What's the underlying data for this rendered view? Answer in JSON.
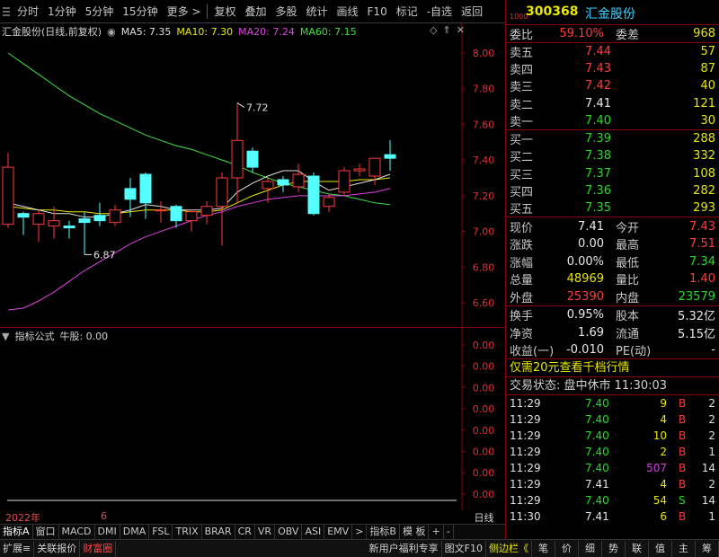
{
  "toolbar": {
    "items": [
      {
        "label": "分时",
        "active": false
      },
      {
        "label": "1分钟",
        "active": false
      },
      {
        "label": "5分钟",
        "active": false
      },
      {
        "label": "15分钟",
        "active": false
      },
      {
        "label": "更多 >",
        "active": false
      },
      {
        "label": "复权",
        "active": false
      },
      {
        "label": "叠加",
        "active": false
      },
      {
        "label": "多股",
        "active": false
      },
      {
        "label": "统计",
        "active": false
      },
      {
        "label": "画线",
        "active": false
      },
      {
        "label": "F10",
        "active": false
      },
      {
        "label": "标记",
        "active": false
      },
      {
        "label": "-自选",
        "active": false
      },
      {
        "label": "返回",
        "active": false
      }
    ]
  },
  "chart_header": {
    "stock_title": "汇金股份(日线,前复权)",
    "ma5": "MA5: 7.35",
    "ma10": "MA10: 7.30",
    "ma20": "MA20: 7.24",
    "ma60": "MA60: 7.15",
    "ctrl_icons": [
      "diamond-icon",
      "up-arrow-icon",
      "close-icon"
    ]
  },
  "indicator_header": {
    "formula": "指标公式",
    "value": "牛股: 0.00"
  },
  "date_axis": {
    "year": "2022年",
    "month": "6"
  },
  "daxian_label": "日线",
  "indicator_tabs": [
    "指标A",
    "窗口",
    "MACD",
    "DMI",
    "DMA",
    "FSL",
    "TRIX",
    "BRAR",
    "CR",
    "VR",
    "OBV",
    "ASI",
    "EMV",
    ">",
    "指标B",
    "模 板",
    "+",
    "-"
  ],
  "bottom_bar": {
    "left": [
      "扩展≡",
      "关联报价",
      "财富圈"
    ],
    "right": [
      "新用户福利专享",
      "图文F10",
      "侧边栏《"
    ],
    "quick": [
      "笔",
      "价",
      "细",
      "势",
      "联",
      "值",
      "主",
      "筹"
    ]
  },
  "right_panel": {
    "num": "1000",
    "code": "300368",
    "name": "汇金股份",
    "weibi": {
      "label": "委比",
      "value": "59.10%",
      "label2": "委差",
      "value2": "968"
    },
    "sell": [
      {
        "label": "卖五",
        "price": "7.44",
        "qty": "57"
      },
      {
        "label": "卖四",
        "price": "7.43",
        "qty": "87"
      },
      {
        "label": "卖三",
        "price": "7.42",
        "qty": "40"
      },
      {
        "label": "卖二",
        "price": "7.41",
        "qty": "121"
      },
      {
        "label": "卖一",
        "price": "7.40",
        "qty": "30"
      }
    ],
    "buy": [
      {
        "label": "买一",
        "price": "7.39",
        "qty": "288"
      },
      {
        "label": "买二",
        "price": "7.38",
        "qty": "332"
      },
      {
        "label": "买三",
        "price": "7.37",
        "qty": "108"
      },
      {
        "label": "买四",
        "price": "7.36",
        "qty": "282"
      },
      {
        "label": "买五",
        "price": "7.35",
        "qty": "293"
      }
    ],
    "stats": [
      {
        "l": "现价",
        "v": "7.41",
        "vc": "white",
        "l2": "今开",
        "v2": "7.43",
        "v2c": "red"
      },
      {
        "l": "涨跌",
        "v": "0.00",
        "vc": "white",
        "l2": "最高",
        "v2": "7.51",
        "v2c": "red"
      },
      {
        "l": "涨幅",
        "v": "0.00%",
        "vc": "white",
        "l2": "最低",
        "v2": "7.34",
        "v2c": "green"
      },
      {
        "l": "总量",
        "v": "48969",
        "vc": "yellow",
        "l2": "量比",
        "v2": "1.40",
        "v2c": "red"
      },
      {
        "l": "外盘",
        "v": "25390",
        "vc": "red",
        "l2": "内盘",
        "v2": "23579",
        "v2c": "green"
      }
    ],
    "stats2": [
      {
        "l": "换手",
        "v": "0.95%",
        "vc": "white",
        "l2": "股本",
        "v2": "5.32亿",
        "v2c": "white"
      },
      {
        "l": "净资",
        "v": "1.69",
        "vc": "white",
        "l2": "流通",
        "v2": "5.15亿",
        "v2c": "white"
      },
      {
        "l": "收益(一)",
        "v": "-0.010",
        "vc": "white",
        "l2": "PE(动)",
        "v2": "-",
        "v2c": "white"
      }
    ],
    "promo": "仅需20元查看千档行情",
    "trade_status": "交易状态: 盘中休市 11:30:03",
    "ticks": [
      {
        "time": "11:29",
        "price": "7.40",
        "pc": "green",
        "vol": "9",
        "vc": "yellow",
        "bs": "B",
        "bsc": "red",
        "n": "2"
      },
      {
        "time": "11:29",
        "price": "7.40",
        "pc": "green",
        "vol": "4",
        "vc": "yellow",
        "bs": "B",
        "bsc": "red",
        "n": "2"
      },
      {
        "time": "11:29",
        "price": "7.40",
        "pc": "green",
        "vol": "10",
        "vc": "yellow",
        "bs": "B",
        "bsc": "red",
        "n": "2"
      },
      {
        "time": "11:29",
        "price": "7.40",
        "pc": "green",
        "vol": "2",
        "vc": "yellow",
        "bs": "B",
        "bsc": "red",
        "n": "1"
      },
      {
        "time": "11:29",
        "price": "7.40",
        "pc": "green",
        "vol": "507",
        "vc": "purple",
        "bs": "B",
        "bsc": "red",
        "n": "14"
      },
      {
        "time": "11:29",
        "price": "7.41",
        "pc": "white",
        "vol": "4",
        "vc": "yellow",
        "bs": "B",
        "bsc": "red",
        "n": "2"
      },
      {
        "time": "11:29",
        "price": "7.40",
        "pc": "green",
        "vol": "54",
        "vc": "yellow",
        "bs": "S",
        "bsc": "green",
        "n": "14"
      },
      {
        "time": "11:30",
        "price": "7.41",
        "pc": "white",
        "vol": "6",
        "vc": "yellow",
        "bs": "B",
        "bsc": "red",
        "n": "1"
      }
    ]
  },
  "chart_data": {
    "type": "candlestick",
    "y_ticks": [
      6.6,
      6.8,
      7.0,
      7.2,
      7.4,
      7.6,
      7.8,
      8.0
    ],
    "ylim": [
      6.55,
      8.1
    ],
    "indicator_y_ticks": [
      "0.00",
      "0.00",
      "0.00",
      "0.00",
      "0.00",
      "0.00",
      "0.00",
      "0.00",
      "0.00"
    ],
    "annotations": [
      {
        "text": "7.72",
        "price": 7.72,
        "candle": 15
      },
      {
        "text": "6.87",
        "price": 6.87,
        "candle": 5
      }
    ],
    "candles": [
      {
        "o": 7.04,
        "h": 7.44,
        "l": 7.02,
        "c": 7.36
      },
      {
        "o": 7.1,
        "h": 7.11,
        "l": 6.98,
        "c": 7.08
      },
      {
        "o": 7.04,
        "h": 7.12,
        "l": 6.94,
        "c": 7.1
      },
      {
        "o": 7.03,
        "h": 7.14,
        "l": 6.96,
        "c": 7.06
      },
      {
        "o": 7.03,
        "h": 7.06,
        "l": 6.96,
        "c": 7.02
      },
      {
        "o": 7.07,
        "h": 7.11,
        "l": 6.87,
        "c": 7.05
      },
      {
        "o": 7.09,
        "h": 7.16,
        "l": 7.03,
        "c": 7.06
      },
      {
        "o": 7.05,
        "h": 7.15,
        "l": 7.03,
        "c": 7.12
      },
      {
        "o": 7.24,
        "h": 7.3,
        "l": 7.08,
        "c": 7.18
      },
      {
        "o": 7.32,
        "h": 7.33,
        "l": 7.07,
        "c": 7.16
      },
      {
        "o": 7.12,
        "h": 7.17,
        "l": 7.05,
        "c": 7.12
      },
      {
        "o": 7.14,
        "h": 7.15,
        "l": 7.02,
        "c": 7.06
      },
      {
        "o": 7.06,
        "h": 7.12,
        "l": 7.0,
        "c": 7.11
      },
      {
        "o": 7.09,
        "h": 7.17,
        "l": 7.04,
        "c": 7.14
      },
      {
        "o": 7.14,
        "h": 7.33,
        "l": 6.92,
        "c": 7.3
      },
      {
        "o": 7.3,
        "h": 7.72,
        "l": 7.16,
        "c": 7.51
      },
      {
        "o": 7.45,
        "h": 7.47,
        "l": 7.33,
        "c": 7.36
      },
      {
        "o": 7.24,
        "h": 7.3,
        "l": 7.16,
        "c": 7.28
      },
      {
        "o": 7.29,
        "h": 7.31,
        "l": 7.22,
        "c": 7.26
      },
      {
        "o": 7.25,
        "h": 7.38,
        "l": 7.22,
        "c": 7.32
      },
      {
        "o": 7.31,
        "h": 7.33,
        "l": 7.09,
        "c": 7.1
      },
      {
        "o": 7.14,
        "h": 7.21,
        "l": 7.11,
        "c": 7.19
      },
      {
        "o": 7.22,
        "h": 7.36,
        "l": 7.2,
        "c": 7.34
      },
      {
        "o": 7.34,
        "h": 7.38,
        "l": 7.31,
        "c": 7.35
      },
      {
        "o": 7.31,
        "h": 7.41,
        "l": 7.26,
        "c": 7.41
      },
      {
        "o": 7.43,
        "h": 7.51,
        "l": 7.34,
        "c": 7.41
      }
    ],
    "ma5": [
      7.16,
      7.14,
      7.12,
      7.1,
      7.1,
      7.08,
      7.08,
      7.1,
      7.12,
      7.15,
      7.14,
      7.12,
      7.12,
      7.12,
      7.13,
      7.22,
      7.27,
      7.31,
      7.34,
      7.34,
      7.28,
      7.23,
      7.25,
      7.27,
      7.29,
      7.32
    ],
    "ma10": [
      7.14,
      7.13,
      7.12,
      7.12,
      7.11,
      7.11,
      7.1,
      7.1,
      7.11,
      7.12,
      7.12,
      7.12,
      7.11,
      7.11,
      7.12,
      7.16,
      7.2,
      7.23,
      7.26,
      7.28,
      7.28,
      7.28,
      7.28,
      7.29,
      7.29,
      7.3
    ],
    "ma20": [
      6.56,
      6.57,
      6.61,
      6.66,
      6.72,
      6.78,
      6.83,
      6.88,
      6.93,
      6.97,
      7.0,
      7.03,
      7.06,
      7.09,
      7.11,
      7.14,
      7.16,
      7.18,
      7.19,
      7.2,
      7.2,
      7.2,
      7.2,
      7.21,
      7.22,
      7.24
    ],
    "ma60": [
      8.0,
      7.94,
      7.88,
      7.82,
      7.76,
      7.71,
      7.66,
      7.62,
      7.58,
      7.54,
      7.51,
      7.48,
      7.46,
      7.43,
      7.4,
      7.37,
      7.33,
      7.3,
      7.27,
      7.25,
      7.23,
      7.21,
      7.2,
      7.18,
      7.16,
      7.15
    ]
  },
  "colors": {
    "up": "#ff3b3b",
    "down": "#54ffff",
    "ma5": "#e0e0e0",
    "ma10": "#e8e800",
    "ma20": "#e040e0",
    "ma60": "#40e040",
    "axis": "#8a0000"
  }
}
